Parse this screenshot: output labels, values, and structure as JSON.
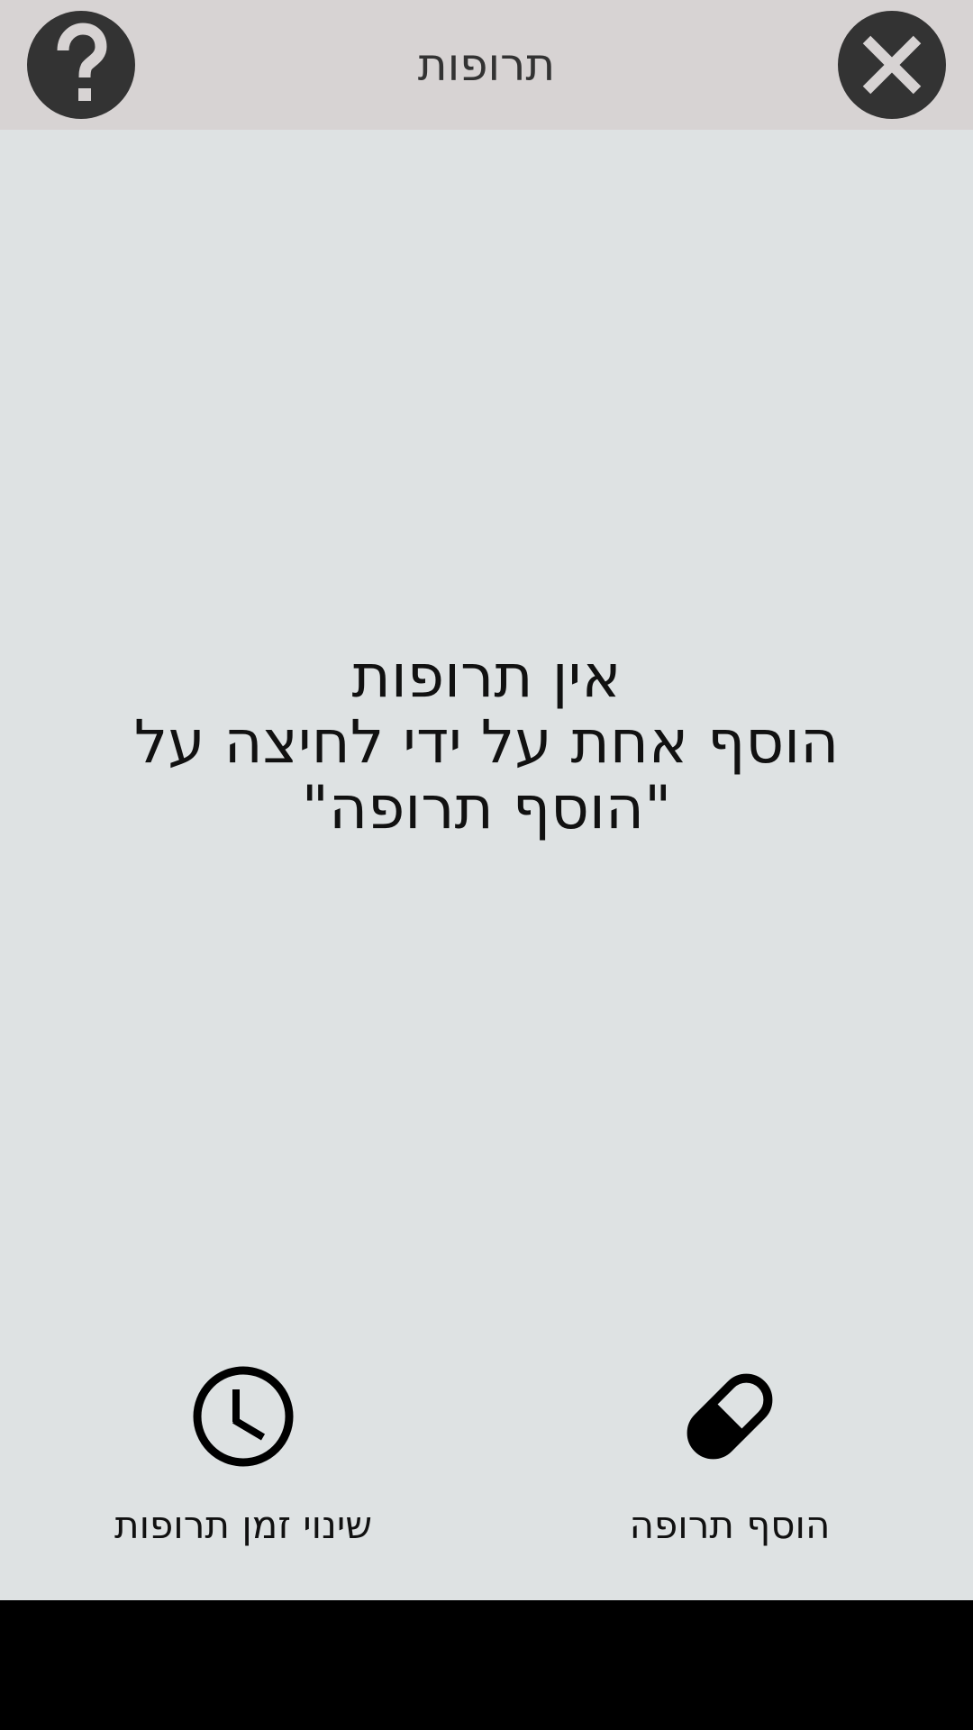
{
  "header": {
    "title": "תרופות"
  },
  "main": {
    "empty_line1": "אין תרופות",
    "empty_line2": "הוסף אחת על ידי לחיצה על",
    "empty_line3": "\"הוסף תרופה\""
  },
  "actions": {
    "add_medicine_label": "הוסף תרופה",
    "change_time_label": "שינוי זמן תרופות"
  },
  "icons": {
    "help": "question-mark-icon",
    "close": "close-x-icon",
    "add_medicine": "pill-icon",
    "change_time": "clock-icon"
  },
  "colors": {
    "header_bg": "#d7d3d3",
    "main_bg": "#dee2e3",
    "button_dark": "#333333",
    "icon_light": "#d7d3d3",
    "text": "#111111"
  }
}
